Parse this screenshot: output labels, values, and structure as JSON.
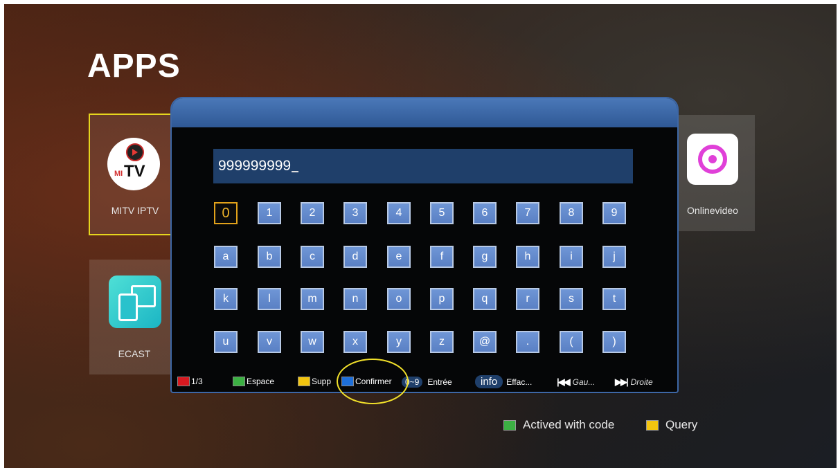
{
  "page_title": "APPS",
  "apps": {
    "mitv": {
      "label": "MITV IPTV",
      "logo_mi": "MI",
      "logo_tv": "TV"
    },
    "ecast": {
      "label": "ECAST"
    },
    "online": {
      "label": "Onlinevideo"
    }
  },
  "keyboard": {
    "input_value": "999999999",
    "rows": [
      [
        "0",
        "1",
        "2",
        "3",
        "4",
        "5",
        "6",
        "7",
        "8",
        "9"
      ],
      [
        "a",
        "b",
        "c",
        "d",
        "e",
        "f",
        "g",
        "h",
        "i",
        "j"
      ],
      [
        "k",
        "l",
        "m",
        "n",
        "o",
        "p",
        "q",
        "r",
        "s",
        "t"
      ],
      [
        "u",
        "v",
        "w",
        "x",
        "y",
        "z",
        "@",
        ".",
        "(",
        ")"
      ]
    ],
    "selected_key": "0"
  },
  "legend": {
    "red_label": "1/3",
    "green_label": "Espace",
    "yellow_label": "Supp",
    "blue_label": "Confirmer",
    "digits_key": "0~9",
    "digits_label": "Entrée",
    "info_key": "info",
    "info_label": "Effac...",
    "prev_label": "Gau...",
    "next_label": "Droite"
  },
  "bottom_legend": {
    "green_label": "Actived with code",
    "yellow_label": "Query"
  },
  "colors": {
    "red": "#d71920",
    "green": "#3cb043",
    "yellow": "#f2c40f",
    "blue": "#1e6fd9",
    "highlight": "#e5d51e"
  },
  "icons": {
    "mitv": "mitv-logo-icon",
    "ecast": "ecast-screen-icon",
    "online": "onlinevideo-play-icon",
    "prev": "skip-previous-icon",
    "next": "skip-next-icon"
  }
}
